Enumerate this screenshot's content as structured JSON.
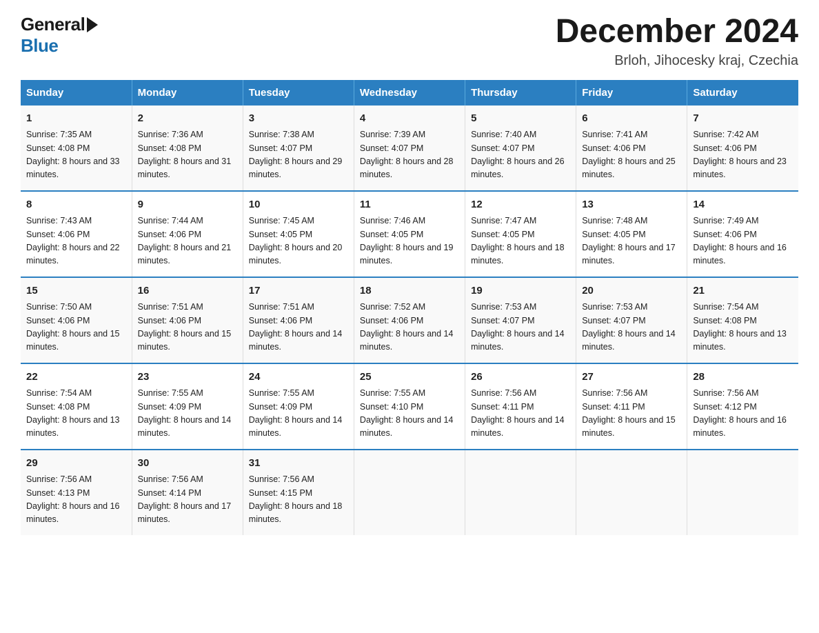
{
  "header": {
    "logo_general": "General",
    "logo_blue": "Blue",
    "month_title": "December 2024",
    "location": "Brloh, Jihocesky kraj, Czechia"
  },
  "days_of_week": [
    "Sunday",
    "Monday",
    "Tuesday",
    "Wednesday",
    "Thursday",
    "Friday",
    "Saturday"
  ],
  "weeks": [
    [
      {
        "day": "1",
        "sunrise": "7:35 AM",
        "sunset": "4:08 PM",
        "daylight": "8 hours and 33 minutes."
      },
      {
        "day": "2",
        "sunrise": "7:36 AM",
        "sunset": "4:08 PM",
        "daylight": "8 hours and 31 minutes."
      },
      {
        "day": "3",
        "sunrise": "7:38 AM",
        "sunset": "4:07 PM",
        "daylight": "8 hours and 29 minutes."
      },
      {
        "day": "4",
        "sunrise": "7:39 AM",
        "sunset": "4:07 PM",
        "daylight": "8 hours and 28 minutes."
      },
      {
        "day": "5",
        "sunrise": "7:40 AM",
        "sunset": "4:07 PM",
        "daylight": "8 hours and 26 minutes."
      },
      {
        "day": "6",
        "sunrise": "7:41 AM",
        "sunset": "4:06 PM",
        "daylight": "8 hours and 25 minutes."
      },
      {
        "day": "7",
        "sunrise": "7:42 AM",
        "sunset": "4:06 PM",
        "daylight": "8 hours and 23 minutes."
      }
    ],
    [
      {
        "day": "8",
        "sunrise": "7:43 AM",
        "sunset": "4:06 PM",
        "daylight": "8 hours and 22 minutes."
      },
      {
        "day": "9",
        "sunrise": "7:44 AM",
        "sunset": "4:06 PM",
        "daylight": "8 hours and 21 minutes."
      },
      {
        "day": "10",
        "sunrise": "7:45 AM",
        "sunset": "4:05 PM",
        "daylight": "8 hours and 20 minutes."
      },
      {
        "day": "11",
        "sunrise": "7:46 AM",
        "sunset": "4:05 PM",
        "daylight": "8 hours and 19 minutes."
      },
      {
        "day": "12",
        "sunrise": "7:47 AM",
        "sunset": "4:05 PM",
        "daylight": "8 hours and 18 minutes."
      },
      {
        "day": "13",
        "sunrise": "7:48 AM",
        "sunset": "4:05 PM",
        "daylight": "8 hours and 17 minutes."
      },
      {
        "day": "14",
        "sunrise": "7:49 AM",
        "sunset": "4:06 PM",
        "daylight": "8 hours and 16 minutes."
      }
    ],
    [
      {
        "day": "15",
        "sunrise": "7:50 AM",
        "sunset": "4:06 PM",
        "daylight": "8 hours and 15 minutes."
      },
      {
        "day": "16",
        "sunrise": "7:51 AM",
        "sunset": "4:06 PM",
        "daylight": "8 hours and 15 minutes."
      },
      {
        "day": "17",
        "sunrise": "7:51 AM",
        "sunset": "4:06 PM",
        "daylight": "8 hours and 14 minutes."
      },
      {
        "day": "18",
        "sunrise": "7:52 AM",
        "sunset": "4:06 PM",
        "daylight": "8 hours and 14 minutes."
      },
      {
        "day": "19",
        "sunrise": "7:53 AM",
        "sunset": "4:07 PM",
        "daylight": "8 hours and 14 minutes."
      },
      {
        "day": "20",
        "sunrise": "7:53 AM",
        "sunset": "4:07 PM",
        "daylight": "8 hours and 14 minutes."
      },
      {
        "day": "21",
        "sunrise": "7:54 AM",
        "sunset": "4:08 PM",
        "daylight": "8 hours and 13 minutes."
      }
    ],
    [
      {
        "day": "22",
        "sunrise": "7:54 AM",
        "sunset": "4:08 PM",
        "daylight": "8 hours and 13 minutes."
      },
      {
        "day": "23",
        "sunrise": "7:55 AM",
        "sunset": "4:09 PM",
        "daylight": "8 hours and 14 minutes."
      },
      {
        "day": "24",
        "sunrise": "7:55 AM",
        "sunset": "4:09 PM",
        "daylight": "8 hours and 14 minutes."
      },
      {
        "day": "25",
        "sunrise": "7:55 AM",
        "sunset": "4:10 PM",
        "daylight": "8 hours and 14 minutes."
      },
      {
        "day": "26",
        "sunrise": "7:56 AM",
        "sunset": "4:11 PM",
        "daylight": "8 hours and 14 minutes."
      },
      {
        "day": "27",
        "sunrise": "7:56 AM",
        "sunset": "4:11 PM",
        "daylight": "8 hours and 15 minutes."
      },
      {
        "day": "28",
        "sunrise": "7:56 AM",
        "sunset": "4:12 PM",
        "daylight": "8 hours and 16 minutes."
      }
    ],
    [
      {
        "day": "29",
        "sunrise": "7:56 AM",
        "sunset": "4:13 PM",
        "daylight": "8 hours and 16 minutes."
      },
      {
        "day": "30",
        "sunrise": "7:56 AM",
        "sunset": "4:14 PM",
        "daylight": "8 hours and 17 minutes."
      },
      {
        "day": "31",
        "sunrise": "7:56 AM",
        "sunset": "4:15 PM",
        "daylight": "8 hours and 18 minutes."
      },
      null,
      null,
      null,
      null
    ]
  ],
  "labels": {
    "sunrise": "Sunrise:",
    "sunset": "Sunset:",
    "daylight": "Daylight:"
  }
}
